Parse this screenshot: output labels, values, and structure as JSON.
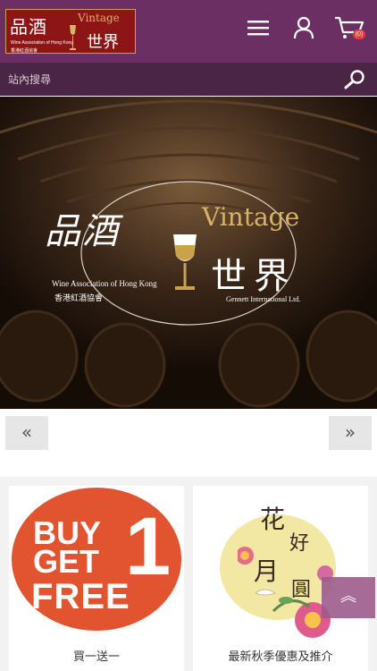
{
  "header": {
    "logo": {
      "zh_primary": "品酒",
      "vintage": "Vintage",
      "zh_secondary": "世界",
      "association_en": "Wine Association of Hong Kong",
      "association_zh": "香港紅酒協會"
    },
    "icons": {
      "menu": "menu-icon",
      "user": "user-icon",
      "cart": "cart-icon"
    },
    "cart_count": "(0)"
  },
  "search": {
    "placeholder": "站內搜尋",
    "value": ""
  },
  "banner": {
    "zh_primary": "品酒",
    "vintage": "Vintage",
    "zh_secondary": "世界",
    "association_en": "Wine Association of Hong Kong",
    "association_zh": "香港紅酒協會",
    "company": "Gennett International Ltd."
  },
  "carousel": {
    "prev_label": "«",
    "next_label": "»"
  },
  "products": [
    {
      "title": "買一送一",
      "image_text": {
        "buy": "BUY",
        "get": "GET",
        "one": "1",
        "free": "FREE"
      }
    },
    {
      "title": "最新秋季優惠及推介",
      "image_text": {
        "c1": "花",
        "c2": "好",
        "c3": "月",
        "c4": "圓"
      }
    }
  ],
  "back_to_top_label": "︽",
  "colors": {
    "header_bg": "#6b2f64",
    "search_bg": "#4b2545",
    "accent": "#9e5c8c",
    "bogo": "#e2542f"
  }
}
